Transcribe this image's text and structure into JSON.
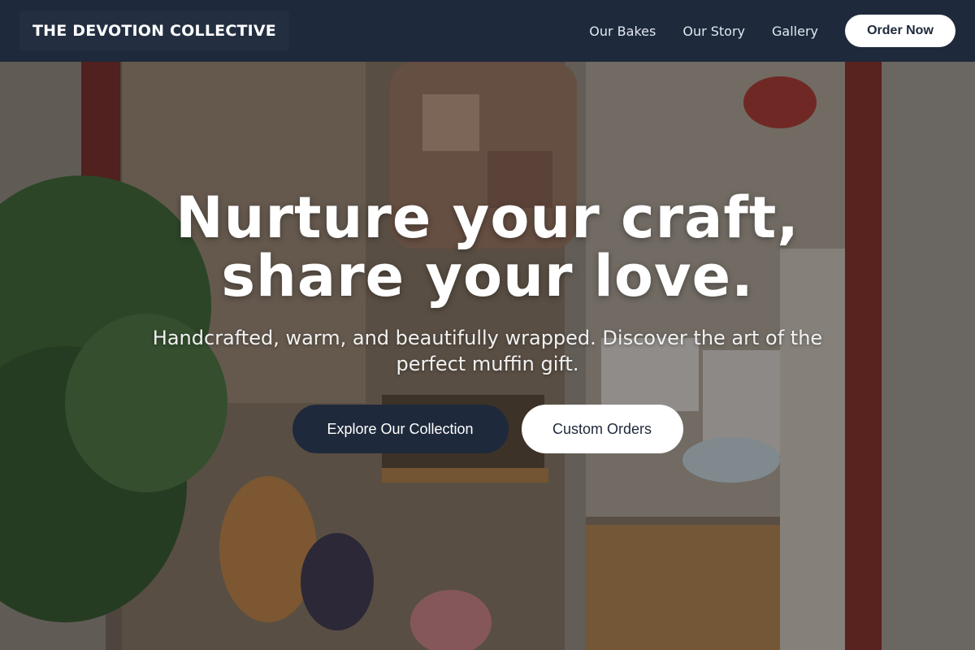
{
  "header": {
    "brand": "THE DEVOTION COLLECTIVE",
    "nav": [
      "Our Bakes",
      "Our Story",
      "Gallery"
    ],
    "order_button": "Order Now"
  },
  "hero": {
    "headline_line1": "Nurture your craft,",
    "headline_line2": "share your love.",
    "subhead": "Handcrafted, warm, and beautifully wrapped. Discover the art of the perfect muffin gift.",
    "primary_cta": "Explore Our Collection",
    "secondary_cta": "Custom Orders",
    "background_image": "shop-window-photo"
  },
  "colors": {
    "navy": "#1e293b",
    "white": "#ffffff"
  }
}
